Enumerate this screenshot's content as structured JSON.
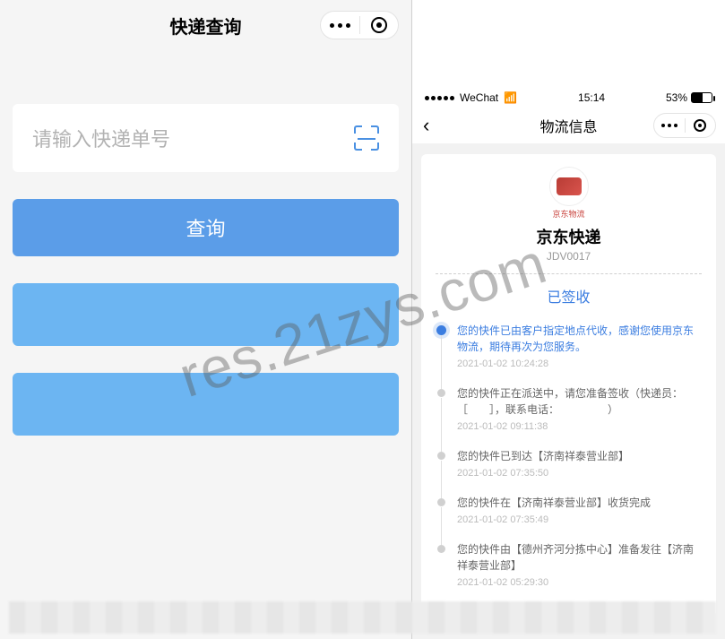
{
  "left": {
    "title": "快递查询",
    "input_placeholder": "请输入快递单号",
    "query_button": "查询"
  },
  "right": {
    "statusbar": {
      "carrier": "WeChat",
      "time": "15:14",
      "battery_pct": "53%"
    },
    "header": {
      "title": "物流信息"
    },
    "courier": {
      "logo_label": "京东物流",
      "name": "京东快递",
      "id": "JDV0017"
    },
    "status": "已签收",
    "timeline": [
      {
        "text": "您的快件已由客户指定地点代收，感谢您使用京东物流，期待再次为您服务。",
        "time": "2021-01-02 10:24:28",
        "active": true
      },
      {
        "text": "您的快件正在派送中，请您准备签收（快递员：［　　］，联系电话：　　　　　）",
        "time": "2021-01-02 09:11:38",
        "active": false
      },
      {
        "text": "您的快件已到达【济南祥泰营业部】",
        "time": "2021-01-02 07:35:50",
        "active": false
      },
      {
        "text": "您的快件在【济南祥泰营业部】收货完成",
        "time": "2021-01-02 07:35:49",
        "active": false
      },
      {
        "text": "您的快件由【德州齐河分拣中心】准备发往【济南祥泰营业部】",
        "time": "2021-01-02 05:29:30",
        "active": false
      }
    ]
  },
  "watermark": "res.21zys.com"
}
